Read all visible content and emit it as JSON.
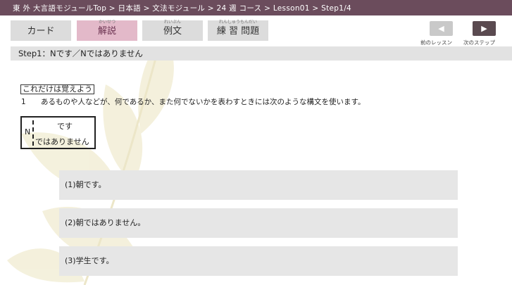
{
  "breadcrumb": "東 外 大言語モジュールTop > 日本語 > 文法モジュール > 24 週 コース > Lesson01 > Step1/4",
  "tabs": [
    {
      "label": "カード",
      "ruby": ""
    },
    {
      "label": "解説",
      "ruby": "かいせつ"
    },
    {
      "label": "例文",
      "ruby": "れいぶん"
    },
    {
      "label": "練 習 問題",
      "ruby": "れんしゅうもんだい"
    }
  ],
  "nav": {
    "prev_label": "前のレッスン",
    "next_label": "次のステップ"
  },
  "step_title": "Step1：Nです／Nではありません",
  "memo": {
    "title": "これだけは覚えよう",
    "rule_number": "1",
    "rule_text": "あるものや人などが、何であるか、また何でないかを表わすときには次のような構文を使います。"
  },
  "pattern": {
    "noun": "N",
    "line1": "です",
    "line2": "ではありません"
  },
  "examples": [
    "(1)朝です。",
    "(2)朝ではありません。",
    "(3)学生です。"
  ],
  "colors": {
    "header": "#6b4c5c",
    "active_tab": "#e3b9c9",
    "inactive_tab": "#dcdcdc",
    "step_bar": "#e2e2e2",
    "example_bg": "#e6e6e6"
  }
}
